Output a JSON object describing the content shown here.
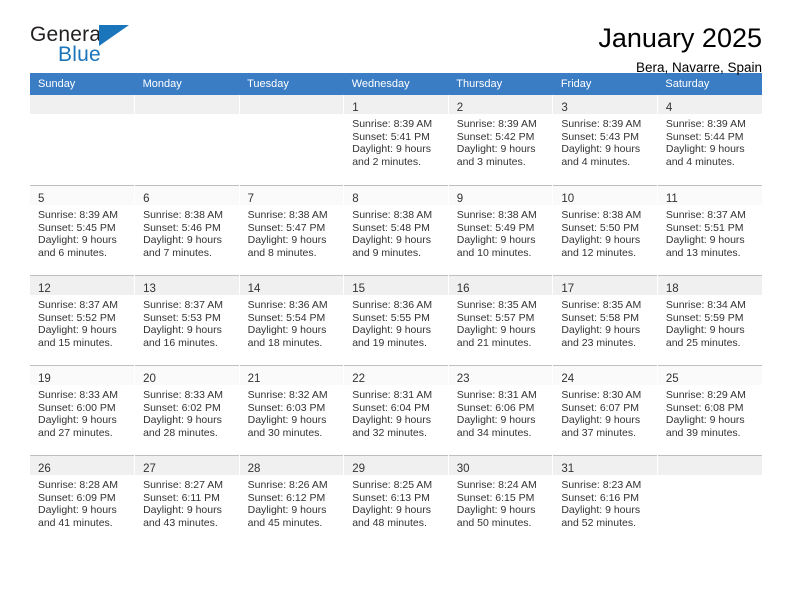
{
  "brand": {
    "name_part1": "General",
    "name_part2": "Blue",
    "flag_icon": "triangle-flag-icon"
  },
  "header": {
    "title": "January 2025",
    "subtitle": "Bera, Navarre, Spain"
  },
  "colors": {
    "header_blue": "#3b7dc4",
    "brand_blue": "#1b75bb",
    "daynum_band": "#f0f0f0",
    "grid_line": "#bfbfbf",
    "text": "#333333"
  },
  "weekdays": [
    "Sunday",
    "Monday",
    "Tuesday",
    "Wednesday",
    "Thursday",
    "Friday",
    "Saturday"
  ],
  "weeks": [
    {
      "shaded": true,
      "days": [
        {
          "empty": true
        },
        {
          "empty": true
        },
        {
          "empty": true
        },
        {
          "day": "1",
          "sunrise": "Sunrise: 8:39 AM",
          "sunset": "Sunset: 5:41 PM",
          "daylight1": "Daylight: 9 hours",
          "daylight2": "and 2 minutes."
        },
        {
          "day": "2",
          "sunrise": "Sunrise: 8:39 AM",
          "sunset": "Sunset: 5:42 PM",
          "daylight1": "Daylight: 9 hours",
          "daylight2": "and 3 minutes."
        },
        {
          "day": "3",
          "sunrise": "Sunrise: 8:39 AM",
          "sunset": "Sunset: 5:43 PM",
          "daylight1": "Daylight: 9 hours",
          "daylight2": "and 4 minutes."
        },
        {
          "day": "4",
          "sunrise": "Sunrise: 8:39 AM",
          "sunset": "Sunset: 5:44 PM",
          "daylight1": "Daylight: 9 hours",
          "daylight2": "and 4 minutes."
        }
      ]
    },
    {
      "shaded": false,
      "days": [
        {
          "day": "5",
          "sunrise": "Sunrise: 8:39 AM",
          "sunset": "Sunset: 5:45 PM",
          "daylight1": "Daylight: 9 hours",
          "daylight2": "and 6 minutes."
        },
        {
          "day": "6",
          "sunrise": "Sunrise: 8:38 AM",
          "sunset": "Sunset: 5:46 PM",
          "daylight1": "Daylight: 9 hours",
          "daylight2": "and 7 minutes."
        },
        {
          "day": "7",
          "sunrise": "Sunrise: 8:38 AM",
          "sunset": "Sunset: 5:47 PM",
          "daylight1": "Daylight: 9 hours",
          "daylight2": "and 8 minutes."
        },
        {
          "day": "8",
          "sunrise": "Sunrise: 8:38 AM",
          "sunset": "Sunset: 5:48 PM",
          "daylight1": "Daylight: 9 hours",
          "daylight2": "and 9 minutes."
        },
        {
          "day": "9",
          "sunrise": "Sunrise: 8:38 AM",
          "sunset": "Sunset: 5:49 PM",
          "daylight1": "Daylight: 9 hours",
          "daylight2": "and 10 minutes."
        },
        {
          "day": "10",
          "sunrise": "Sunrise: 8:38 AM",
          "sunset": "Sunset: 5:50 PM",
          "daylight1": "Daylight: 9 hours",
          "daylight2": "and 12 minutes."
        },
        {
          "day": "11",
          "sunrise": "Sunrise: 8:37 AM",
          "sunset": "Sunset: 5:51 PM",
          "daylight1": "Daylight: 9 hours",
          "daylight2": "and 13 minutes."
        }
      ]
    },
    {
      "shaded": true,
      "days": [
        {
          "day": "12",
          "sunrise": "Sunrise: 8:37 AM",
          "sunset": "Sunset: 5:52 PM",
          "daylight1": "Daylight: 9 hours",
          "daylight2": "and 15 minutes."
        },
        {
          "day": "13",
          "sunrise": "Sunrise: 8:37 AM",
          "sunset": "Sunset: 5:53 PM",
          "daylight1": "Daylight: 9 hours",
          "daylight2": "and 16 minutes."
        },
        {
          "day": "14",
          "sunrise": "Sunrise: 8:36 AM",
          "sunset": "Sunset: 5:54 PM",
          "daylight1": "Daylight: 9 hours",
          "daylight2": "and 18 minutes."
        },
        {
          "day": "15",
          "sunrise": "Sunrise: 8:36 AM",
          "sunset": "Sunset: 5:55 PM",
          "daylight1": "Daylight: 9 hours",
          "daylight2": "and 19 minutes."
        },
        {
          "day": "16",
          "sunrise": "Sunrise: 8:35 AM",
          "sunset": "Sunset: 5:57 PM",
          "daylight1": "Daylight: 9 hours",
          "daylight2": "and 21 minutes."
        },
        {
          "day": "17",
          "sunrise": "Sunrise: 8:35 AM",
          "sunset": "Sunset: 5:58 PM",
          "daylight1": "Daylight: 9 hours",
          "daylight2": "and 23 minutes."
        },
        {
          "day": "18",
          "sunrise": "Sunrise: 8:34 AM",
          "sunset": "Sunset: 5:59 PM",
          "daylight1": "Daylight: 9 hours",
          "daylight2": "and 25 minutes."
        }
      ]
    },
    {
      "shaded": false,
      "days": [
        {
          "day": "19",
          "sunrise": "Sunrise: 8:33 AM",
          "sunset": "Sunset: 6:00 PM",
          "daylight1": "Daylight: 9 hours",
          "daylight2": "and 27 minutes."
        },
        {
          "day": "20",
          "sunrise": "Sunrise: 8:33 AM",
          "sunset": "Sunset: 6:02 PM",
          "daylight1": "Daylight: 9 hours",
          "daylight2": "and 28 minutes."
        },
        {
          "day": "21",
          "sunrise": "Sunrise: 8:32 AM",
          "sunset": "Sunset: 6:03 PM",
          "daylight1": "Daylight: 9 hours",
          "daylight2": "and 30 minutes."
        },
        {
          "day": "22",
          "sunrise": "Sunrise: 8:31 AM",
          "sunset": "Sunset: 6:04 PM",
          "daylight1": "Daylight: 9 hours",
          "daylight2": "and 32 minutes."
        },
        {
          "day": "23",
          "sunrise": "Sunrise: 8:31 AM",
          "sunset": "Sunset: 6:06 PM",
          "daylight1": "Daylight: 9 hours",
          "daylight2": "and 34 minutes."
        },
        {
          "day": "24",
          "sunrise": "Sunrise: 8:30 AM",
          "sunset": "Sunset: 6:07 PM",
          "daylight1": "Daylight: 9 hours",
          "daylight2": "and 37 minutes."
        },
        {
          "day": "25",
          "sunrise": "Sunrise: 8:29 AM",
          "sunset": "Sunset: 6:08 PM",
          "daylight1": "Daylight: 9 hours",
          "daylight2": "and 39 minutes."
        }
      ]
    },
    {
      "shaded": true,
      "days": [
        {
          "day": "26",
          "sunrise": "Sunrise: 8:28 AM",
          "sunset": "Sunset: 6:09 PM",
          "daylight1": "Daylight: 9 hours",
          "daylight2": "and 41 minutes."
        },
        {
          "day": "27",
          "sunrise": "Sunrise: 8:27 AM",
          "sunset": "Sunset: 6:11 PM",
          "daylight1": "Daylight: 9 hours",
          "daylight2": "and 43 minutes."
        },
        {
          "day": "28",
          "sunrise": "Sunrise: 8:26 AM",
          "sunset": "Sunset: 6:12 PM",
          "daylight1": "Daylight: 9 hours",
          "daylight2": "and 45 minutes."
        },
        {
          "day": "29",
          "sunrise": "Sunrise: 8:25 AM",
          "sunset": "Sunset: 6:13 PM",
          "daylight1": "Daylight: 9 hours",
          "daylight2": "and 48 minutes."
        },
        {
          "day": "30",
          "sunrise": "Sunrise: 8:24 AM",
          "sunset": "Sunset: 6:15 PM",
          "daylight1": "Daylight: 9 hours",
          "daylight2": "and 50 minutes."
        },
        {
          "day": "31",
          "sunrise": "Sunrise: 8:23 AM",
          "sunset": "Sunset: 6:16 PM",
          "daylight1": "Daylight: 9 hours",
          "daylight2": "and 52 minutes."
        },
        {
          "empty": true
        }
      ]
    }
  ]
}
